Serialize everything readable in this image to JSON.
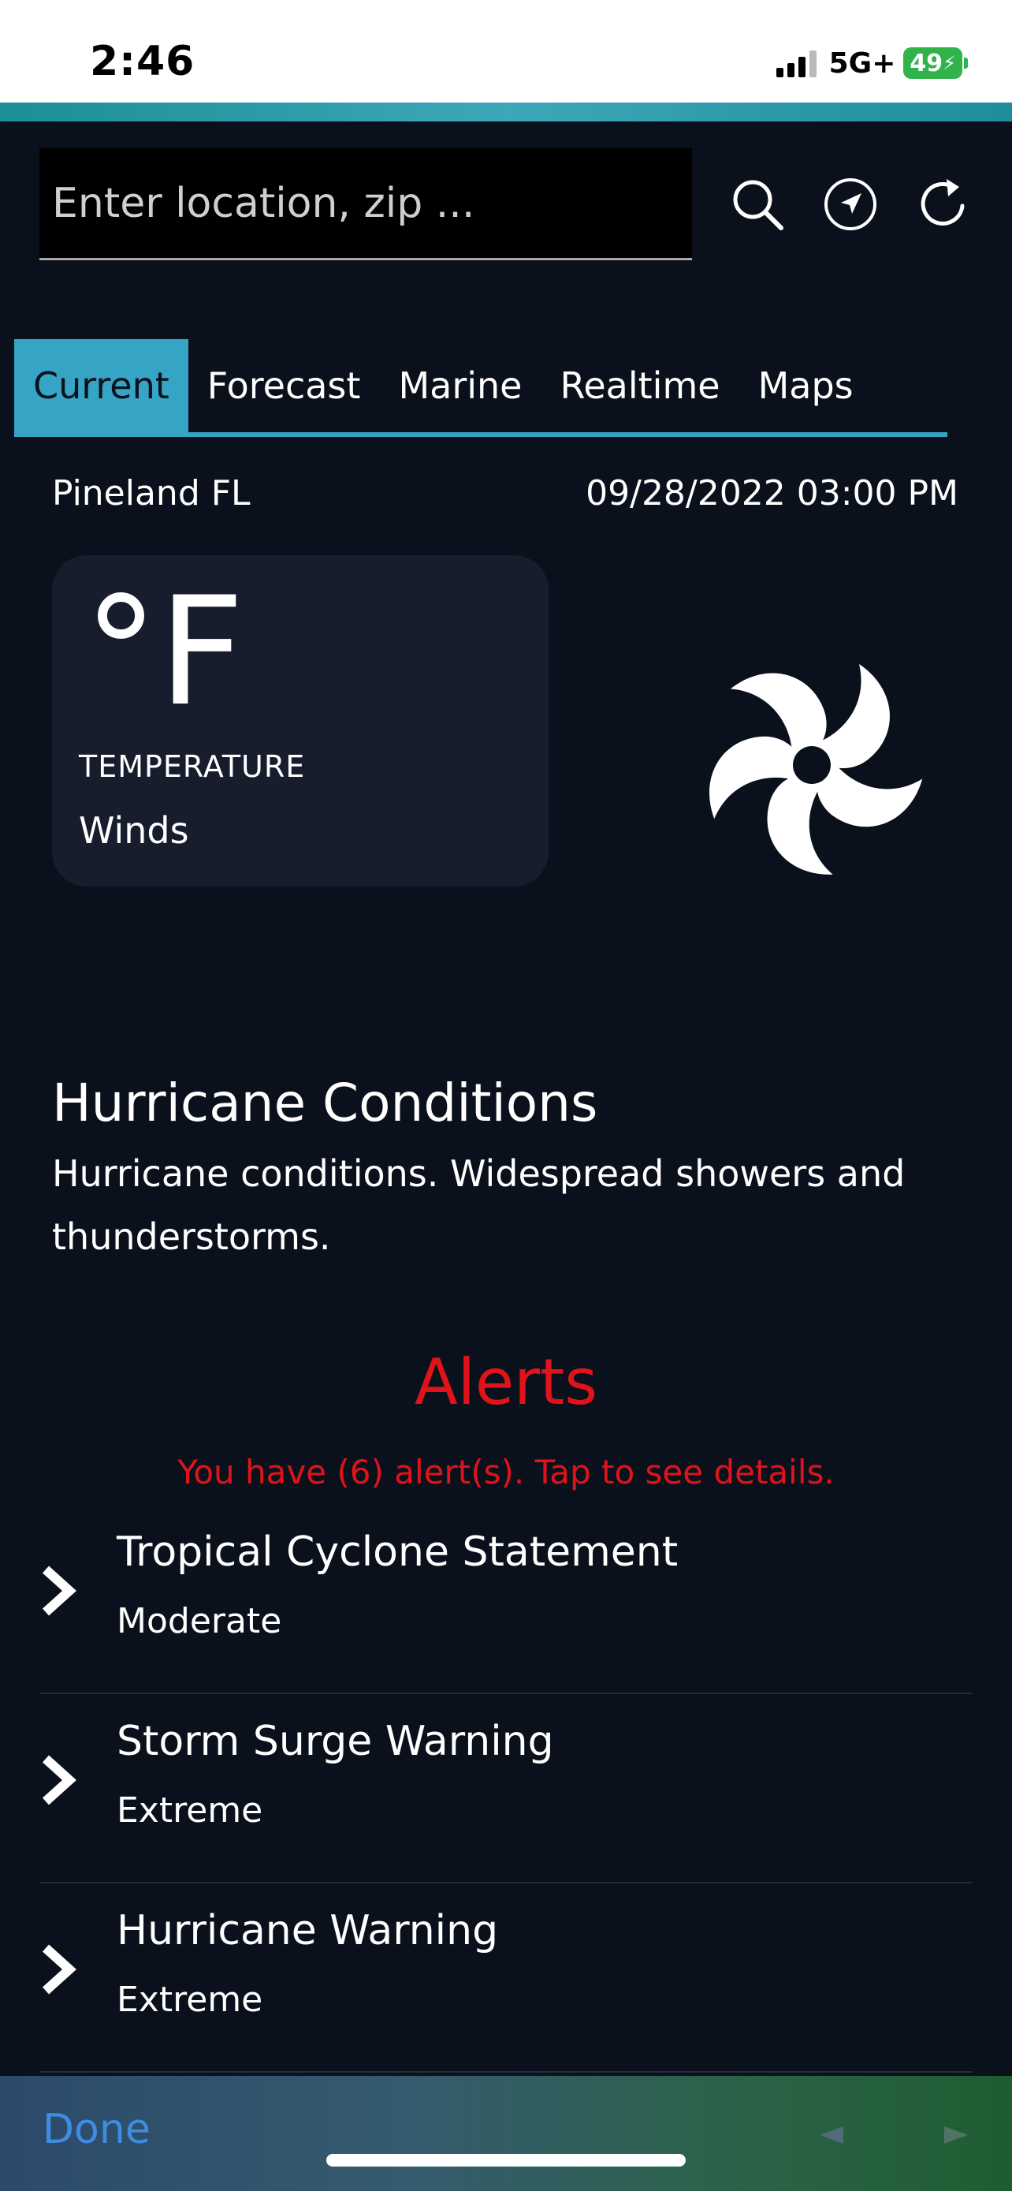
{
  "status_bar": {
    "time": "2:46",
    "network": "5G+",
    "battery": "49"
  },
  "search": {
    "placeholder": "Enter location, zip ..."
  },
  "tabs": [
    {
      "label": "Current",
      "active": true
    },
    {
      "label": "Forecast",
      "active": false
    },
    {
      "label": "Marine",
      "active": false
    },
    {
      "label": "Realtime",
      "active": false
    },
    {
      "label": "Maps",
      "active": false
    }
  ],
  "current": {
    "location": "Pineland FL",
    "datetime": "09/28/2022 03:00 PM",
    "temp_unit": "°F",
    "temp_label": "TEMPERATURE",
    "winds_label": "Winds",
    "condition_icon": "hurricane-icon",
    "condition_title": "Hurricane Conditions",
    "condition_desc": "Hurricane conditions. Widespread showers and thunderstorms."
  },
  "alerts": {
    "title": "Alerts",
    "summary": "You have (6) alert(s). Tap to see details.",
    "items": [
      {
        "title": "Tropical Cyclone Statement",
        "severity": "Moderate"
      },
      {
        "title": "Storm Surge Warning",
        "severity": "Extreme"
      },
      {
        "title": "Hurricane Warning",
        "severity": "Extreme"
      }
    ]
  },
  "toolbar": {
    "done_label": "Done"
  },
  "colors": {
    "background": "#0b111c",
    "accent": "#36a4c4",
    "alert_red": "#e0131a",
    "card": "#171d2c",
    "done_blue": "#3f8ce0"
  }
}
